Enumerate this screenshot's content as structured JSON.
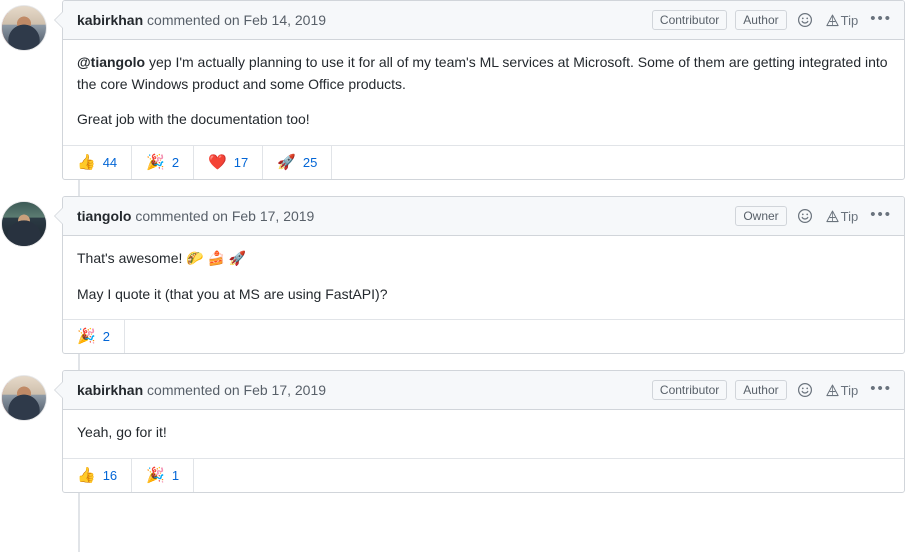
{
  "thread": {
    "comments": [
      {
        "author": "kabirkhan",
        "avatar_style": "avatar-kabirkhan",
        "meta": " commented on Feb 14, 2019",
        "badges": [
          "Contributor",
          "Author"
        ],
        "tip_label": "Tip",
        "kebab_label": "•••",
        "paragraphs": [
          {
            "mention": "@tiangolo",
            "text": " yep I'm actually planning to use it for all of my team's ML services at Microsoft. Some of them are getting integrated into the core Windows product and some Office products."
          },
          {
            "mention": "",
            "text": "Great job with the documentation too!"
          }
        ],
        "reactions": [
          {
            "emoji": "👍",
            "name": "thumbs-up",
            "count": "44"
          },
          {
            "emoji": "🎉",
            "name": "party-popper",
            "count": "2"
          },
          {
            "emoji": "❤️",
            "name": "heart",
            "count": "17"
          },
          {
            "emoji": "🚀",
            "name": "rocket",
            "count": "25"
          }
        ]
      },
      {
        "author": "tiangolo",
        "avatar_style": "avatar-tiangolo",
        "meta": " commented on Feb 17, 2019",
        "badges": [
          "Owner"
        ],
        "tip_label": "Tip",
        "kebab_label": "•••",
        "paragraphs": [
          {
            "mention": "",
            "text": "That's awesome! 🌮 🍰 🚀"
          },
          {
            "mention": "",
            "text": "May I quote it (that you at MS are using FastAPI)?"
          }
        ],
        "reactions": [
          {
            "emoji": "🎉",
            "name": "party-popper",
            "count": "2"
          }
        ]
      },
      {
        "author": "kabirkhan",
        "avatar_style": "avatar-kabirkhan",
        "meta": " commented on Feb 17, 2019",
        "badges": [
          "Contributor",
          "Author"
        ],
        "tip_label": "Tip",
        "kebab_label": "•••",
        "paragraphs": [
          {
            "mention": "",
            "text": "Yeah, go for it!"
          }
        ],
        "reactions": [
          {
            "emoji": "👍",
            "name": "thumbs-up",
            "count": "16"
          },
          {
            "emoji": "🎉",
            "name": "party-popper",
            "count": "1"
          }
        ]
      }
    ]
  },
  "colors": {
    "link": "#0366d6",
    "muted": "#586069",
    "header_bg": "#f6f8fa",
    "border": "#d1d5da",
    "rail": "#e1e4e8"
  }
}
